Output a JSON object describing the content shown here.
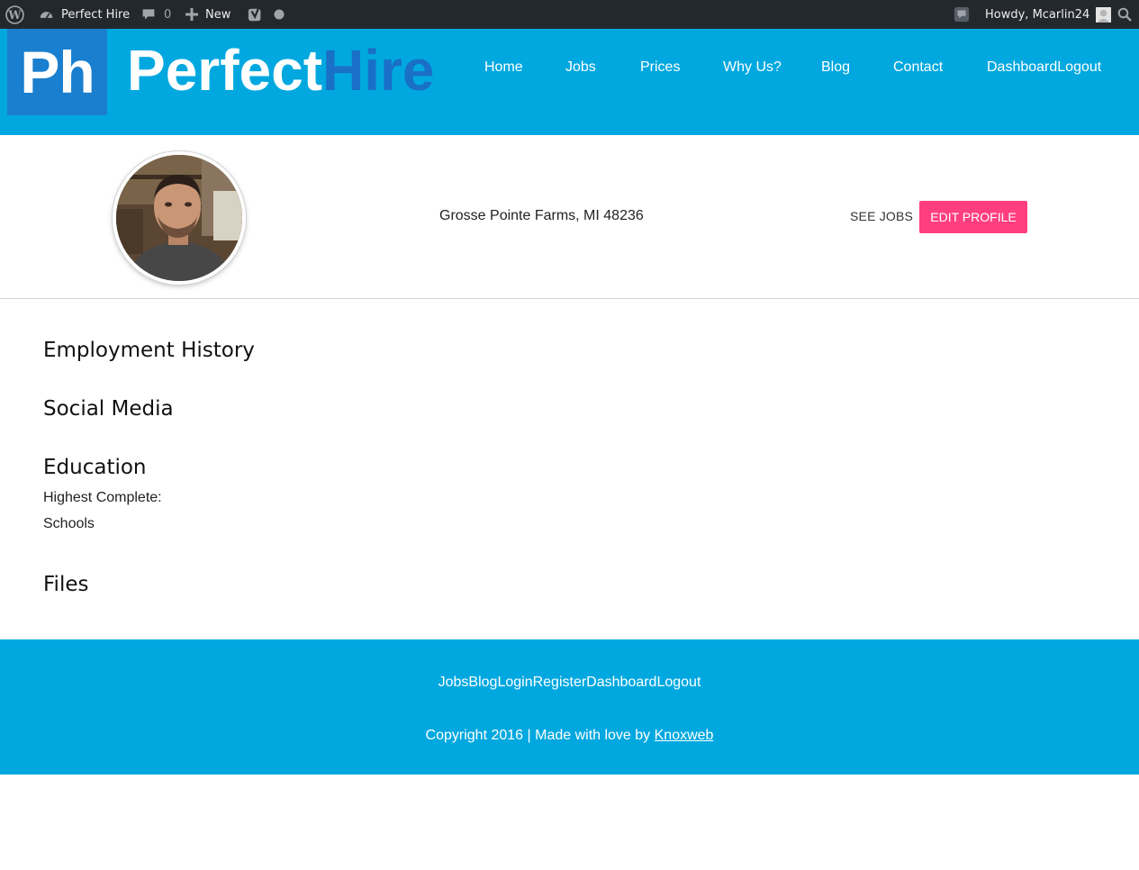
{
  "adminbar": {
    "site_name": "Perfect Hire",
    "comments_count": "0",
    "new_label": "New",
    "greeting": "Howdy, Mcarlin24"
  },
  "logo": {
    "mark": "Ph",
    "word1": "Perfect",
    "word2": "Hire"
  },
  "nav": {
    "items": [
      "Home",
      "Jobs",
      "Prices",
      "Why Us?",
      "Blog",
      "Contact",
      "DashboardLogout"
    ]
  },
  "profile": {
    "location": "Grosse Pointe Farms, MI 48236",
    "see_jobs": "SEE JOBS",
    "edit_profile": "EDIT PROFILE"
  },
  "sections": {
    "employment": "Employment History",
    "social": "Social Media",
    "education": "Education",
    "highest_complete": "Highest Complete:",
    "schools": "Schools",
    "files": "Files"
  },
  "footer": {
    "links": [
      "Jobs",
      "Blog",
      "Login",
      "Register",
      "Dashboard",
      "Logout"
    ],
    "copyright_prefix": "Copyright 2016 | Made with love by ",
    "copyright_link": "Knoxweb"
  },
  "colors": {
    "brand_blue": "#00a8df",
    "logo_blue": "#1a7fce",
    "accent_pink": "#ff3e7f",
    "adminbar": "#23282d"
  },
  "icons": [
    "wordpress-icon",
    "dashboard-gauge-icon",
    "comment-icon",
    "plus-icon",
    "yoast-icon",
    "status-dot-icon",
    "notification-icon",
    "user-avatar-icon",
    "search-icon"
  ]
}
